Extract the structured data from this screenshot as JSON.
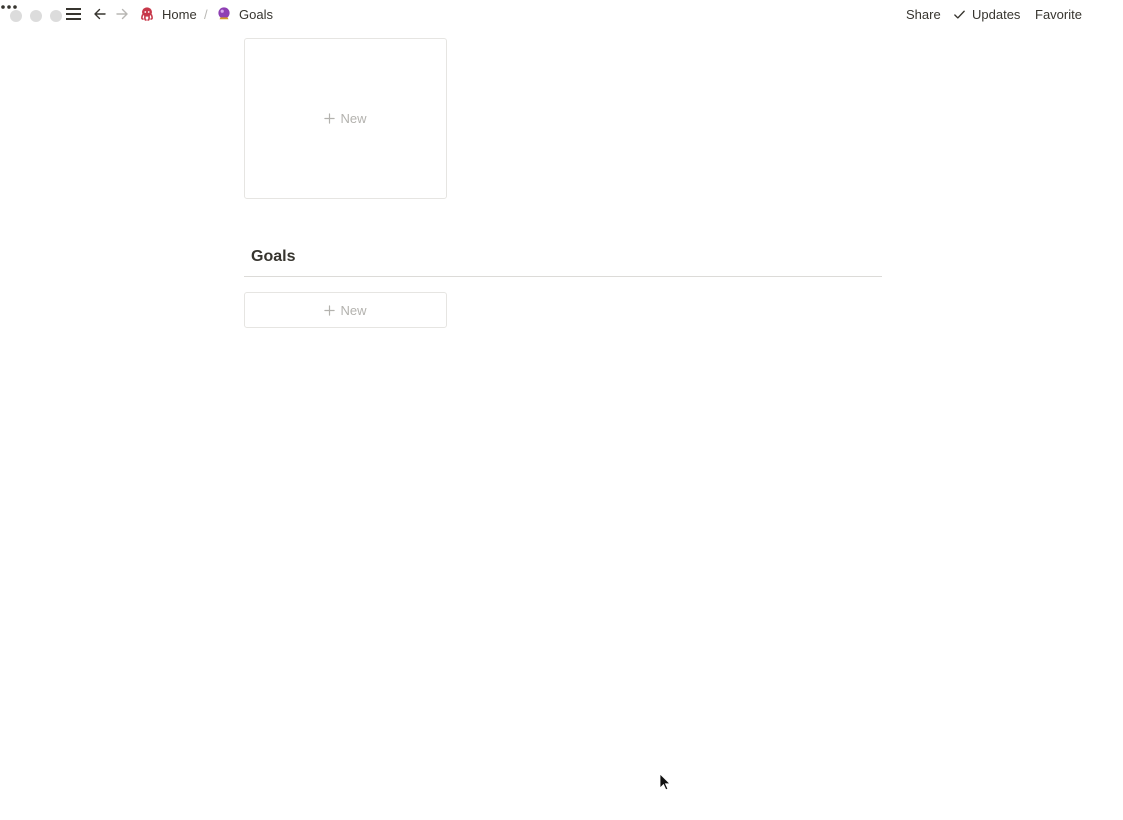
{
  "topbar": {
    "breadcrumb": {
      "home_label": "Home",
      "separator": "/",
      "current_label": "Goals"
    },
    "actions": {
      "share_label": "Share",
      "updates_label": "Updates",
      "favorite_label": "Favorite"
    }
  },
  "gallery": {
    "new_card_label": "New"
  },
  "section": {
    "title": "Goals",
    "new_row_label": "New"
  },
  "colors": {
    "text": "#37352f",
    "muted": "#b3b2ae",
    "border": "#e6e5e2",
    "traffic_light": "#dcdcdc"
  }
}
